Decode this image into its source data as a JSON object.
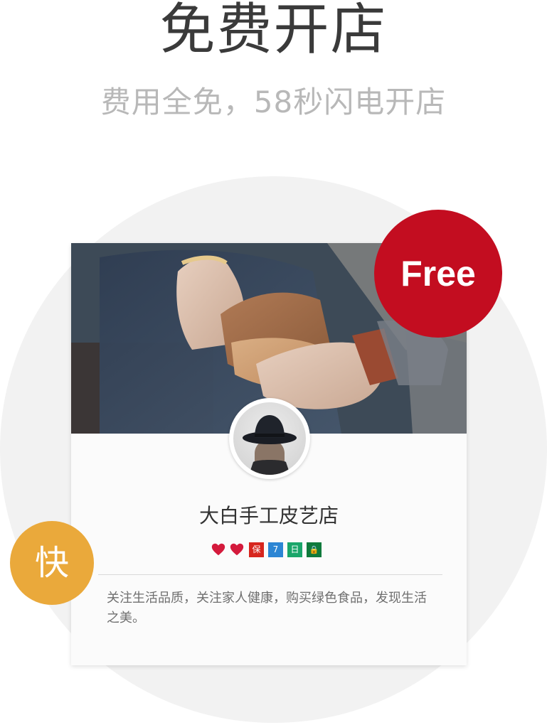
{
  "header": {
    "title": "免费开店",
    "subtitle": "费用全免，58秒闪电开店"
  },
  "badges": {
    "free": "Free",
    "fast": "快"
  },
  "store_card": {
    "name": "大白手工皮艺店",
    "icons": [
      {
        "name": "heart-icon",
        "color": "#d41a3c"
      },
      {
        "name": "heart-icon",
        "color": "#d41a3c"
      },
      {
        "name": "guarantee-badge",
        "label": "保",
        "color": "#d7261e"
      },
      {
        "name": "seven-day-return-badge",
        "label": "7",
        "color": "#2c86d4"
      },
      {
        "name": "calendar-badge",
        "label": "日",
        "color": "#1aa66a"
      },
      {
        "name": "lock-badge",
        "label": "🔒",
        "color": "#0f7a3c"
      }
    ],
    "description": "关注生活品质，关注家人健康，购买绿色食品，发现生活之美。"
  },
  "colors": {
    "free_red": "#c30d20",
    "fast_orange": "#eaa93b",
    "background_circle": "#f2f2f2"
  }
}
